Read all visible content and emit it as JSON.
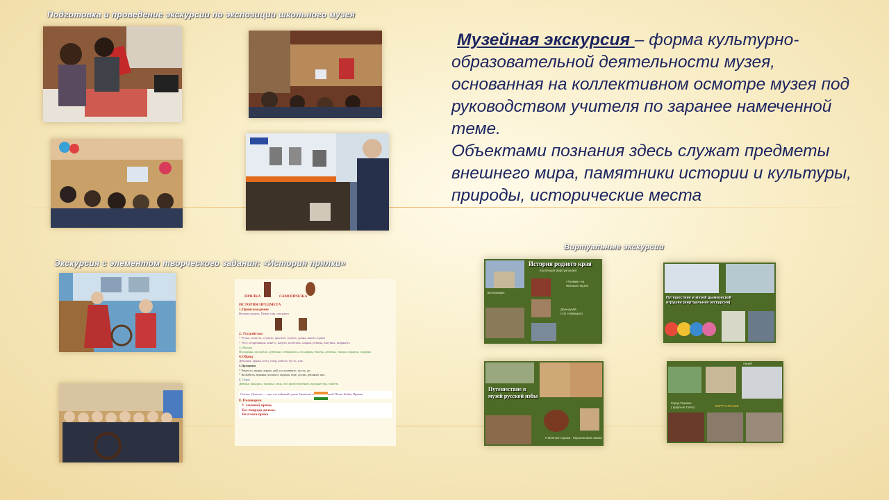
{
  "captions": {
    "top_left": "Подготовка и проведение  экскурсии     по экспозиции школьного музея",
    "middle_left": "Экскурсия с элементом творческого задания: «История прялки»",
    "virtual": "Виртуальные      экскурсии"
  },
  "definition": {
    "term": "Музейная экскурсия ",
    "rest": "– форма культурно-образовательной деятельности музея, основанная на коллективном осмотре музея под руководством учителя по заранее намеченной теме.",
    "second": "Объектами познания здесь служат предметы внешнего мира, памятники истории и культуры, природы, исторические места"
  },
  "document": {
    "heading_left": "ПРЯЛКА",
    "heading_right": "САМОПРЯЛКА",
    "title": "ИСТОРИЯ ПРЕДМЕТА",
    "s1": "1.Происхождение",
    "s1_text": "Велиоустроить. Пими. пар. плотного",
    "s2": "2. Устройство",
    "s2_text1": "* Ручка, лопасть, ступать, прялоть. отдель, длина, шаить, пряха",
    "s2_text2": "* Угол, покровники, конесс, надеть, колёсыть, шарни, ремень, катушка, шпрянеть",
    "s3": "3.Обычаи",
    "s3_text": "Посадины, посидели, девушки, собирались, посадины, ёшьбы, девочка, танцы, подарок, подарка",
    "s4": "4.Обряд",
    "s4_text": "Девушка, пряжа, отец, смэр, работа, бусть, пля",
    "s5": "5.Предания",
    "s5_text1": "* Ремесло, пряка, марка, дей, по долевыть, пость, до.",
    "s5_text2": "* Колыбель, пряжка, колокол, мадана, ещё, доски, дешный, яль",
    "s6": "6. Связь",
    "s6_text": "Девица, шандась, ткачиха, лень, что приготовление, празднества, ткачеть",
    "s7_text": "Сказка: Девичье — про ахстойнный грамъ       Значение имущественной Пшик Бойки Прялки",
    "s8": "8. Поговорки",
    "list": [
      "У ленивой пряхи,",
      "Без повреда дольке.",
      "Не плоха пряха"
    ]
  },
  "virtual_slides": {
    "s1_title": "История родного края",
    "s1_sub": "Коллекция (виртуальная)",
    "s1_notes": [
      "Экспозиции:",
      "«Туемик» на",
      "Филиале музея",
      "Дом-музей",
      "Н.И. Новицкого"
    ],
    "s2_title": "Путешествие в музей дымковской игрушки (виртуальная экскурсия)",
    "s3_title": "Путешествие в музей русской избы",
    "s3_notes": [
      "Глиняные горшки",
      "Керосиновая лампа"
    ],
    "s4_notes": [
      "Город Пушкин",
      "( Царское Село)",
      "ВИРТУАЛЬНЫЕ"
    ],
    "s4_top": "лицей"
  },
  "colors": {
    "text": "#1d2560",
    "slide_green": "#4d6b26",
    "caption_shadow": "#555555"
  }
}
